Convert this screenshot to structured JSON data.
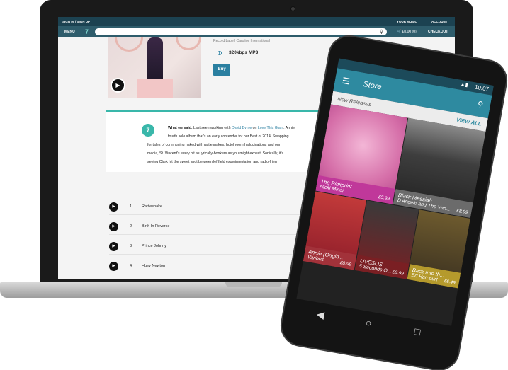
{
  "site": {
    "signin_label": "SIGN IN / SIGN UP",
    "your_music_label": "YOUR MUSIC",
    "account_label": "ACCOUNT",
    "menu_label": "MENU",
    "logo_glyph": "7",
    "search_placeholder": "",
    "cart_label": "£0.00 (0)",
    "checkout_label": "CHECKOUT",
    "record_label": "Record Label: Caroline International",
    "format_label": "320kbps MP3",
    "price_cut": "£",
    "buy_label": "Buy",
    "review": {
      "badge": "7",
      "line1_prefix": "What we said:",
      "line1_text": " Last seen working with ",
      "line1_link1": "David Byrne",
      "line1_mid": " on ",
      "line1_link2": "Love This Giant",
      "line1_end": ", Annie",
      "line2": "fourth solo album that's an early contender for our Best of 2014. Swapping",
      "line3": "for tales of communing naked with rattlesnakes, hotel room hallucinations and our",
      "line4": "media, St. Vincent's every bit as lyrically-bonkers as you might expect. Sonically, it's",
      "line5": "seeing Clark hit the sweet spot between leftfield experimentation and radio-frien"
    },
    "tracks": [
      {
        "num": "1",
        "title": "Rattlesnake"
      },
      {
        "num": "2",
        "title": "Birth In Reverse"
      },
      {
        "num": "3",
        "title": "Prince Johnny"
      },
      {
        "num": "4",
        "title": "Huey Newton"
      }
    ]
  },
  "phone": {
    "time": "10:07",
    "app_title": "Store",
    "section_title": "New Releases",
    "view_all_label": "VIEW ALL",
    "releases": [
      {
        "title": "The Pinkprint",
        "artist": "Nicki Minaj",
        "price": "£5.99",
        "cap_color": "#c0389a"
      },
      {
        "title": "Black Messiah",
        "artist": "D'Angelo and The Van...",
        "price": "£8.99",
        "cap_color": "#6b6b6b"
      },
      {
        "title": "Annie (Origin...",
        "artist": "Various",
        "price": "£8.99",
        "cap_color": "#a2323a"
      },
      {
        "title": "LIVESOS",
        "artist": "5 Seconds O...",
        "price": "£8.99",
        "cap_color": "#7a1f23"
      },
      {
        "title": "Back Into th...",
        "artist": "Ed Harcourt",
        "price": "£6.49",
        "cap_color": "#b59a2c"
      }
    ]
  },
  "colors": {
    "accent_teal": "#39b7aa",
    "header_dark": "#1c4251",
    "link_blue": "#2a7fa0",
    "app_bar": "#2e8aa0"
  }
}
